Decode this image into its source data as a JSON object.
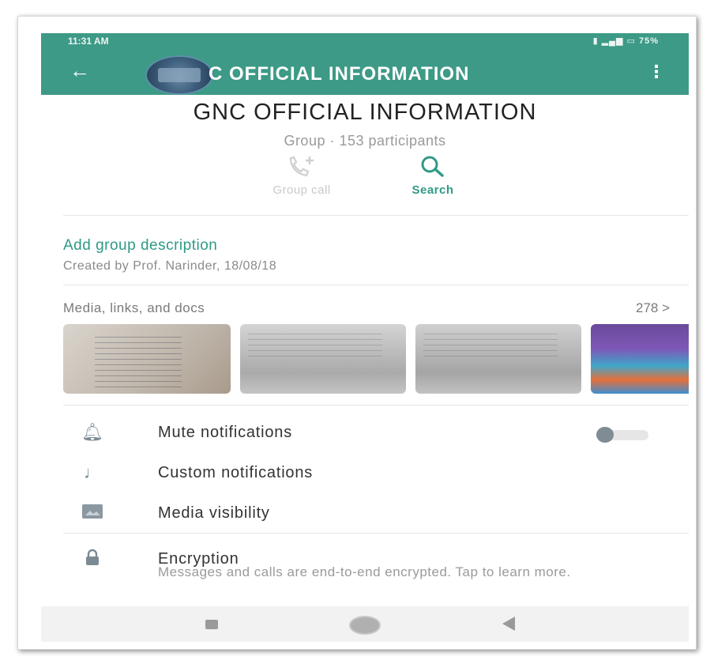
{
  "status_bar": {
    "time": "11:31 AM",
    "right": "75%"
  },
  "app_bar": {
    "title": "C OFFICIAL INFORMATION"
  },
  "header": {
    "group_name": "GNC OFFICIAL INFORMATION",
    "subtitle": "Group · 153 participants"
  },
  "actions": {
    "group_call": {
      "label": "Group call",
      "icon": "group-call-icon",
      "color": "#c9c9c9"
    },
    "search": {
      "label": "Search",
      "icon": "search-icon",
      "color": "#2e9a86"
    }
  },
  "description": {
    "add_label": "Add group description",
    "created_by": "Created by Prof. Narinder, 18/08/18"
  },
  "media": {
    "label": "Media, links, and docs",
    "count": "278 >"
  },
  "settings": [
    {
      "label": "Mute notifications",
      "icon": "bell-icon"
    },
    {
      "label": "Custom notifications",
      "icon": "music-note-icon"
    },
    {
      "label": "Media visibility",
      "icon": "image-icon"
    }
  ],
  "mute_toggle": {
    "on": false
  },
  "encryption": {
    "label": "Encryption",
    "subtext": "Messages and calls are end-to-end encrypted. Tap to learn more.",
    "icon": "lock-icon"
  },
  "colors": {
    "accent": "#3d9a86",
    "link": "#2e9a86"
  }
}
